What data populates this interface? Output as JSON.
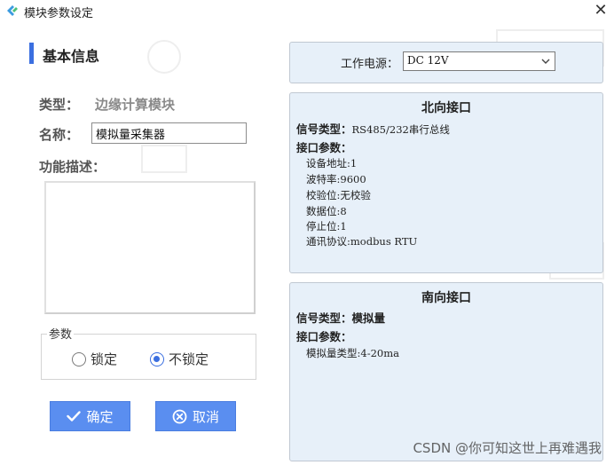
{
  "window": {
    "title": "模块参数设定",
    "close_glyph": "✕",
    "logo_icon": "app-logo-icon"
  },
  "basic_info": {
    "section_title": "基本信息",
    "type_label": "类型：",
    "type_value": "边缘计算模块",
    "name_label": "名称：",
    "name_value": "模拟量采集器",
    "desc_label": "功能描述：",
    "desc_value": ""
  },
  "params": {
    "legend": "参数",
    "options": [
      "锁定",
      "不锁定"
    ],
    "selected_index": 1
  },
  "buttons": {
    "ok_label": "确定",
    "cancel_label": "取消"
  },
  "power": {
    "label": "工作电源：",
    "value": "DC 12V"
  },
  "north": {
    "title": "北向接口",
    "signal_label": "信号类型：",
    "signal_value": "RS485/232串行总线",
    "params_label": "接口参数：",
    "lines": [
      "设备地址:1",
      "波特率:9600",
      "校验位:无校验",
      "数据位:8",
      "停止位:1",
      "通讯协议:modbus RTU"
    ]
  },
  "south": {
    "title": "南向接口",
    "signal_label": "信号类型：",
    "signal_value": "模拟量",
    "params_label": "接口参数：",
    "lines": [
      "模拟量类型:4-20ma"
    ]
  },
  "watermark": "CSDN @你可知这世上再难遇我",
  "colors": {
    "accent": "#3b6fe0",
    "button": "#5a8ef0",
    "panel_bg": "#e7f0f9"
  }
}
